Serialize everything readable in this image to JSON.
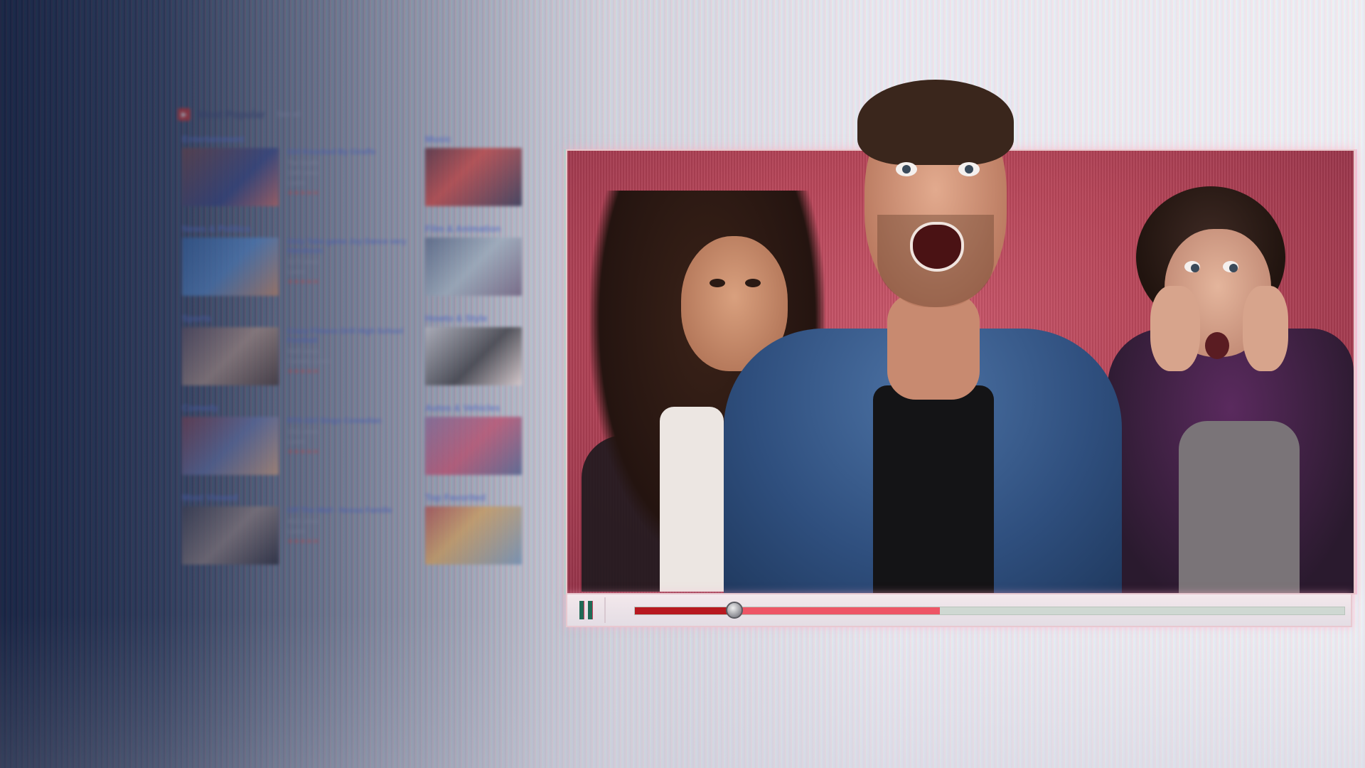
{
  "listing": {
    "header": {
      "title": "Most Popular",
      "subtitle": "See all"
    },
    "left_categories": [
      {
        "title": "Entertainment",
        "video": {
          "title": "Girl Knocked By Giraffe",
          "line2": "The Giraffe",
          "meta1": "2345 views",
          "meta2": "Lorem",
          "stars": "★★★★★",
          "thumb": "t1"
        }
      },
      {
        "title": "News & Politics",
        "video": {
          "title": "Only Take game Joy Dance very Handsom",
          "line2": "",
          "meta1": "3172 views",
          "meta2": "Lorem",
          "stars": "★★★★★",
          "thumb": "t2"
        }
      },
      {
        "title": "Sports",
        "video": {
          "title": "Crazy Fitness Drill High School Football",
          "line2": "",
          "meta1": "5645 views",
          "meta2": "Comedy Lorem",
          "stars": "★★★★★",
          "thumb": "t3"
        }
      },
      {
        "title": "Comedy",
        "video": {
          "title": "RTA Girl Sings Comedian",
          "line2": "",
          "meta1": "2311 views",
          "meta2": "Lorem",
          "stars": "★★★★★",
          "thumb": "t4"
        }
      },
      {
        "title": "Most Viewed",
        "video": {
          "title": "Off The Wall - Nossa Famille",
          "line2": "",
          "meta1": "4021 views",
          "meta2": "Lorem",
          "stars": "★★★★★",
          "thumb": "t5"
        }
      }
    ],
    "right_categories": [
      {
        "title": "Music",
        "thumb": "r1"
      },
      {
        "title": "Film & Animation",
        "thumb": "r2"
      },
      {
        "title": "Howto & Style",
        "thumb": "r3"
      },
      {
        "title": "Autos & Vehicles",
        "thumb": "r4"
      },
      {
        "title": "Top Favorited",
        "thumb": "r5"
      }
    ]
  },
  "player": {
    "state": "playing",
    "progress_fraction": 0.14,
    "buffered_fraction": 0.43,
    "icons": {
      "pause": "pause-icon"
    },
    "colors": {
      "played": "#b81820",
      "buffered": "#ee5566",
      "track": "#cfd8d2",
      "video_bg": "#b54457"
    }
  }
}
